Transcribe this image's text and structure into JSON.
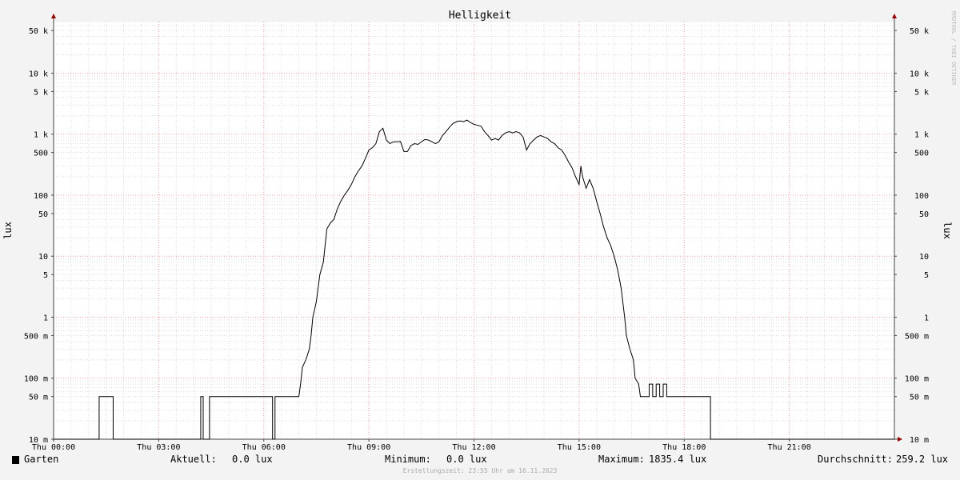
{
  "colors": {
    "background": "#f3f3f3",
    "canvas": "#ffffff",
    "grid_minor": "#dcdcdc",
    "grid_major": "#e8a0a0",
    "line": "#000000",
    "axis_arrow": "#990000",
    "watermark": "#bbbbbb"
  },
  "watermark": "RRDTOOL / TOBI OETIKER",
  "chart_data": {
    "type": "line",
    "title": "Helligkeit",
    "ylabel": "lux",
    "ylabel_right": "lux",
    "y_scale": "log",
    "ylim": [
      0.01,
      70000
    ],
    "xlim": [
      0,
      24
    ],
    "grid": true,
    "x_ticks": [
      {
        "v": 0,
        "label": "Thu 00:00"
      },
      {
        "v": 3,
        "label": "Thu 03:00"
      },
      {
        "v": 6,
        "label": "Thu 06:00"
      },
      {
        "v": 9,
        "label": "Thu 09:00"
      },
      {
        "v": 12,
        "label": "Thu 12:00"
      },
      {
        "v": 15,
        "label": "Thu 15:00"
      },
      {
        "v": 18,
        "label": "Thu 18:00"
      },
      {
        "v": 21,
        "label": "Thu 21:00"
      }
    ],
    "y_ticks": [
      {
        "v": 0.01,
        "label": "10 m"
      },
      {
        "v": 0.05,
        "label": "50 m"
      },
      {
        "v": 0.1,
        "label": "100 m"
      },
      {
        "v": 0.5,
        "label": "500 m"
      },
      {
        "v": 1,
        "label": "1"
      },
      {
        "v": 5,
        "label": "5"
      },
      {
        "v": 10,
        "label": "10"
      },
      {
        "v": 50,
        "label": "50"
      },
      {
        "v": 100,
        "label": "100"
      },
      {
        "v": 500,
        "label": "500"
      },
      {
        "v": 1000,
        "label": "1 k"
      },
      {
        "v": 5000,
        "label": "5 k"
      },
      {
        "v": 10000,
        "label": "10 k"
      },
      {
        "v": 50000,
        "label": "50 k"
      }
    ],
    "series": [
      {
        "name": "Garten",
        "color": "#000000",
        "points": [
          [
            0,
            0.01
          ],
          [
            1.3,
            0.01
          ],
          [
            1.3,
            0.05
          ],
          [
            1.7,
            0.05
          ],
          [
            1.7,
            0.01
          ],
          [
            4.2,
            0.01
          ],
          [
            4.2,
            0.05
          ],
          [
            4.27,
            0.05
          ],
          [
            4.27,
            0.01
          ],
          [
            4.45,
            0.01
          ],
          [
            4.45,
            0.05
          ],
          [
            6.25,
            0.05
          ],
          [
            6.25,
            0.01
          ],
          [
            6.32,
            0.01
          ],
          [
            6.32,
            0.05
          ],
          [
            7.0,
            0.05
          ],
          [
            7.05,
            0.08
          ],
          [
            7.1,
            0.15
          ],
          [
            7.2,
            0.2
          ],
          [
            7.3,
            0.3
          ],
          [
            7.35,
            0.5
          ],
          [
            7.4,
            1
          ],
          [
            7.5,
            1.8
          ],
          [
            7.6,
            5
          ],
          [
            7.7,
            8
          ],
          [
            7.75,
            15
          ],
          [
            7.8,
            28
          ],
          [
            7.9,
            35
          ],
          [
            8.0,
            40
          ],
          [
            8.1,
            60
          ],
          [
            8.2,
            80
          ],
          [
            8.3,
            100
          ],
          [
            8.4,
            120
          ],
          [
            8.5,
            150
          ],
          [
            8.6,
            200
          ],
          [
            8.7,
            250
          ],
          [
            8.8,
            300
          ],
          [
            8.9,
            400
          ],
          [
            9.0,
            550
          ],
          [
            9.1,
            600
          ],
          [
            9.2,
            700
          ],
          [
            9.3,
            1100
          ],
          [
            9.4,
            1250
          ],
          [
            9.5,
            800
          ],
          [
            9.6,
            700
          ],
          [
            9.7,
            750
          ],
          [
            9.8,
            750
          ],
          [
            9.9,
            760
          ],
          [
            10.0,
            520
          ],
          [
            10.1,
            520
          ],
          [
            10.2,
            650
          ],
          [
            10.3,
            700
          ],
          [
            10.4,
            680
          ],
          [
            10.5,
            750
          ],
          [
            10.6,
            820
          ],
          [
            10.7,
            800
          ],
          [
            10.8,
            750
          ],
          [
            10.9,
            700
          ],
          [
            11.0,
            750
          ],
          [
            11.1,
            950
          ],
          [
            11.2,
            1100
          ],
          [
            11.3,
            1300
          ],
          [
            11.4,
            1500
          ],
          [
            11.5,
            1600
          ],
          [
            11.6,
            1650
          ],
          [
            11.7,
            1600
          ],
          [
            11.8,
            1700
          ],
          [
            11.9,
            1550
          ],
          [
            12.0,
            1450
          ],
          [
            12.1,
            1400
          ],
          [
            12.2,
            1350
          ],
          [
            12.3,
            1100
          ],
          [
            12.4,
            950
          ],
          [
            12.5,
            800
          ],
          [
            12.6,
            850
          ],
          [
            12.7,
            800
          ],
          [
            12.8,
            950
          ],
          [
            12.9,
            1050
          ],
          [
            13.0,
            1100
          ],
          [
            13.1,
            1050
          ],
          [
            13.2,
            1100
          ],
          [
            13.3,
            1050
          ],
          [
            13.4,
            900
          ],
          [
            13.5,
            550
          ],
          [
            13.6,
            700
          ],
          [
            13.7,
            800
          ],
          [
            13.8,
            900
          ],
          [
            13.9,
            950
          ],
          [
            14.0,
            900
          ],
          [
            14.1,
            850
          ],
          [
            14.2,
            750
          ],
          [
            14.3,
            700
          ],
          [
            14.4,
            600
          ],
          [
            14.5,
            550
          ],
          [
            14.6,
            450
          ],
          [
            14.7,
            350
          ],
          [
            14.8,
            280
          ],
          [
            14.9,
            200
          ],
          [
            15.0,
            150
          ],
          [
            15.05,
            300
          ],
          [
            15.1,
            200
          ],
          [
            15.2,
            130
          ],
          [
            15.3,
            180
          ],
          [
            15.4,
            130
          ],
          [
            15.5,
            80
          ],
          [
            15.6,
            50
          ],
          [
            15.7,
            30
          ],
          [
            15.8,
            20
          ],
          [
            15.9,
            15
          ],
          [
            16.0,
            10
          ],
          [
            16.1,
            6
          ],
          [
            16.2,
            3
          ],
          [
            16.3,
            1
          ],
          [
            16.35,
            0.5
          ],
          [
            16.45,
            0.3
          ],
          [
            16.55,
            0.2
          ],
          [
            16.6,
            0.1
          ],
          [
            16.7,
            0.08
          ],
          [
            16.75,
            0.05
          ],
          [
            17.0,
            0.05
          ],
          [
            17.0,
            0.08
          ],
          [
            17.1,
            0.08
          ],
          [
            17.1,
            0.05
          ],
          [
            17.2,
            0.05
          ],
          [
            17.2,
            0.08
          ],
          [
            17.3,
            0.08
          ],
          [
            17.3,
            0.05
          ],
          [
            17.4,
            0.05
          ],
          [
            17.4,
            0.08
          ],
          [
            17.5,
            0.08
          ],
          [
            17.5,
            0.05
          ],
          [
            18.75,
            0.05
          ],
          [
            18.75,
            0.01
          ],
          [
            24,
            0.01
          ]
        ]
      }
    ]
  },
  "legend": {
    "series_name": "Garten",
    "current_label": "Aktuell:",
    "current_value": "0.0 lux",
    "minimum_label": "Minimum:",
    "minimum_value": "0.0 lux",
    "maximum_label": "Maximum:",
    "maximum_value": "1835.4 lux",
    "average_label": "Durchschnitt:",
    "average_value": "259.2 lux"
  },
  "footer_text": "Erstellungszeit: 23:55 Uhr am 16.11.2023"
}
